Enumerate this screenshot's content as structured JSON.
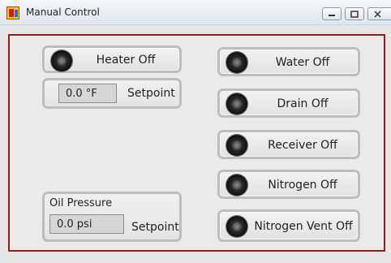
{
  "window": {
    "title": "Manual Control",
    "controls": [
      "minimize",
      "restore",
      "close"
    ]
  },
  "heater": {
    "button_label": "Heater Off",
    "temp_value": "0.0 °F",
    "temp_label": "Setpoint"
  },
  "oil": {
    "title": "Oil Pressure",
    "value": "0.0 psi",
    "label": "Setpoint"
  },
  "valves": [
    {
      "label": "Water Off"
    },
    {
      "label": "Drain Off"
    },
    {
      "label": "Receiver Off"
    },
    {
      "label": "Nitrogen Off"
    },
    {
      "label": "Nitrogen Vent Off"
    }
  ],
  "colors": {
    "frame_border": "#8f1f1f",
    "button_border": "#bdbdbd",
    "lamp_off": "#1a1a1a"
  }
}
